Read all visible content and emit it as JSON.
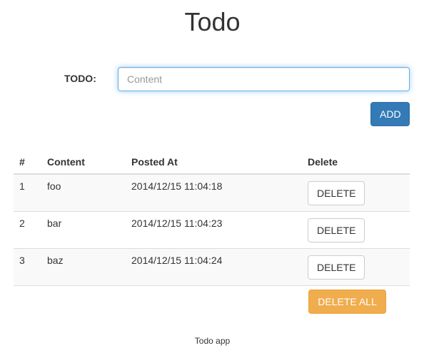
{
  "header": {
    "title": "Todo"
  },
  "form": {
    "label": "TODO:",
    "input_value": "",
    "input_placeholder": "Content",
    "add_label": "ADD"
  },
  "table": {
    "headers": {
      "num": "#",
      "content": "Content",
      "posted_at": "Posted At",
      "delete": "Delete"
    },
    "rows": [
      {
        "num": "1",
        "content": "foo",
        "posted_at": "2014/12/15 11:04:18",
        "delete_label": "DELETE"
      },
      {
        "num": "2",
        "content": "bar",
        "posted_at": "2014/12/15 11:04:23",
        "delete_label": "DELETE"
      },
      {
        "num": "3",
        "content": "baz",
        "posted_at": "2014/12/15 11:04:24",
        "delete_label": "DELETE"
      }
    ]
  },
  "actions": {
    "delete_all_label": "DELETE ALL"
  },
  "footer": {
    "text": "Todo app"
  },
  "colors": {
    "primary": "#337ab7",
    "warning": "#f0ad4e",
    "focus_border": "#66afe9",
    "text": "#333333"
  }
}
